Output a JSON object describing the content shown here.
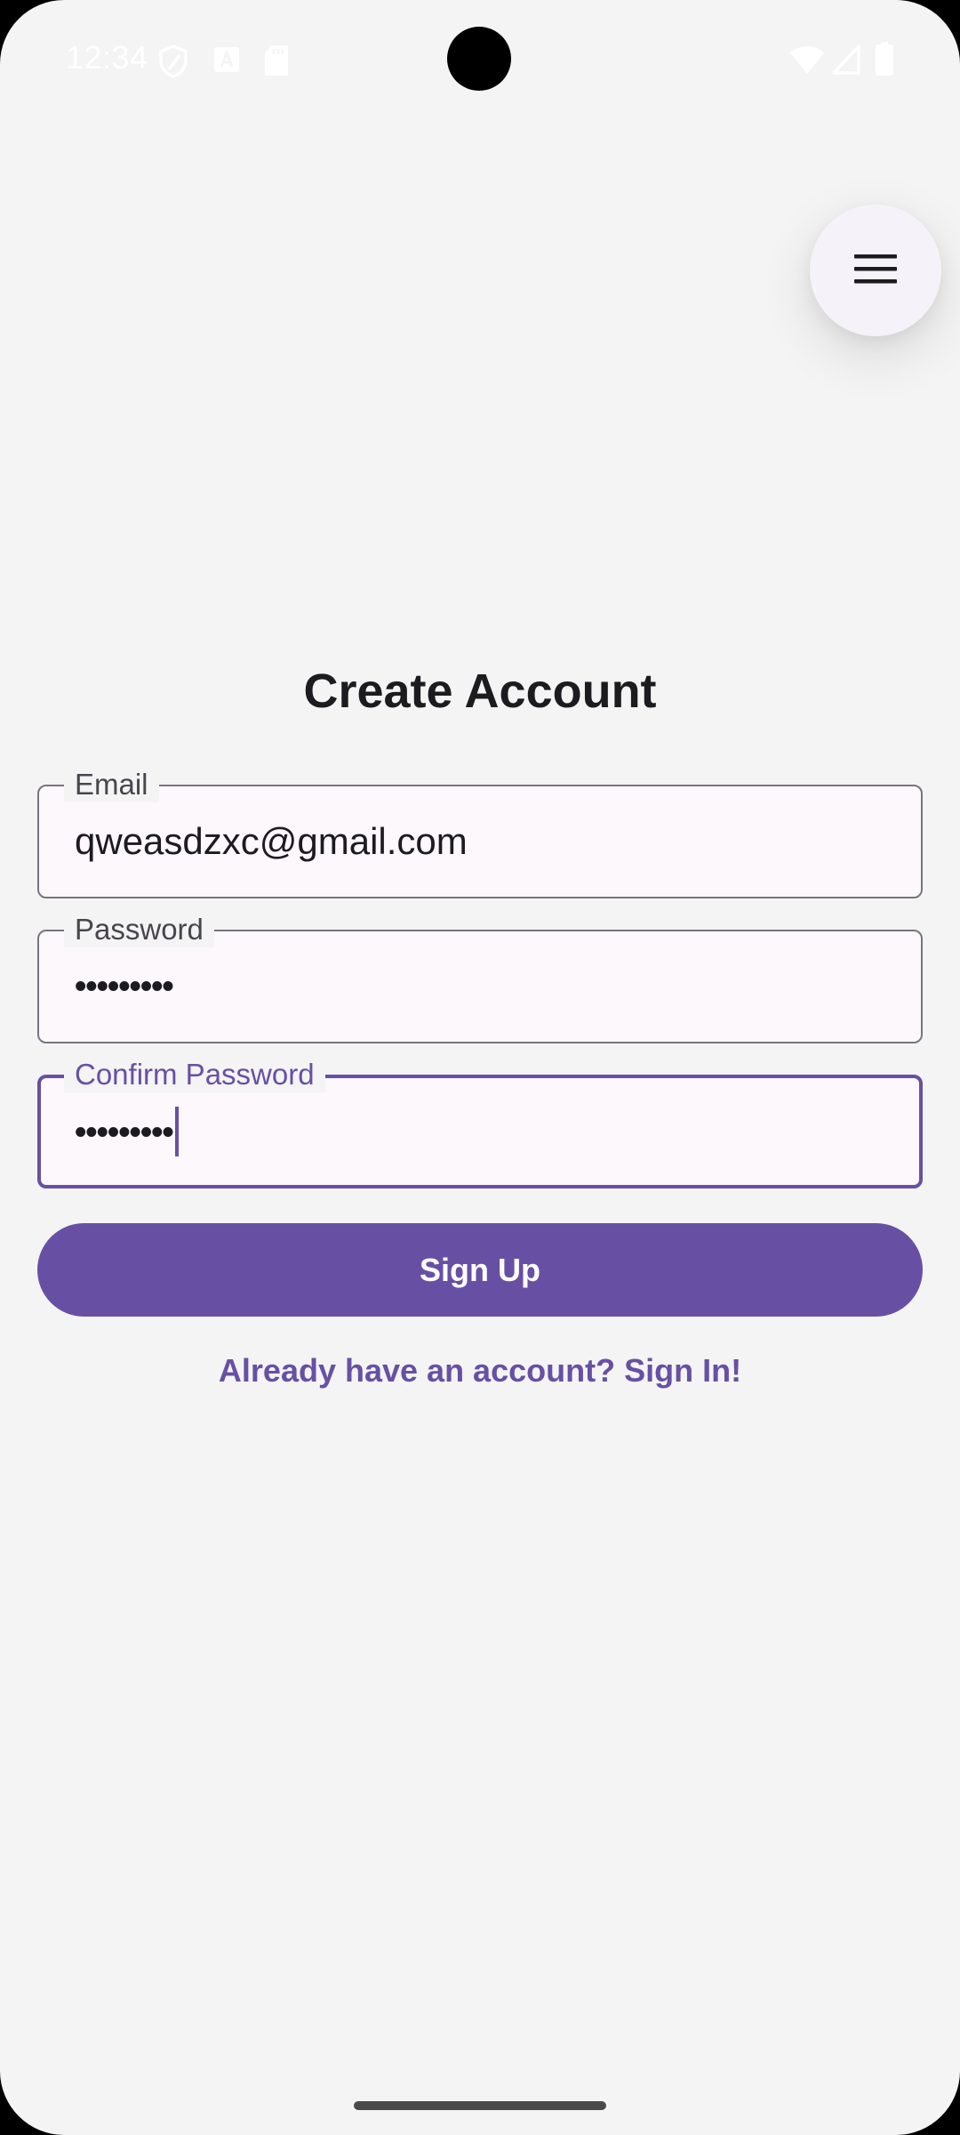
{
  "status_bar": {
    "time": "12:34"
  },
  "header": {
    "menu_icon": "menu-icon"
  },
  "form": {
    "title": "Create Account",
    "email": {
      "label": "Email",
      "value": "qweasdzxc@gmail.com"
    },
    "password": {
      "label": "Password",
      "value": "•••••••••"
    },
    "confirm_password": {
      "label": "Confirm Password",
      "value": "•••••••••"
    },
    "signup_label": "Sign Up",
    "signin_link": "Already have an account? Sign In!"
  },
  "colors": {
    "primary": "#6750a4",
    "background": "#f4f4f4",
    "field_fill": "#fdf8fc",
    "outline": "#79747e"
  }
}
